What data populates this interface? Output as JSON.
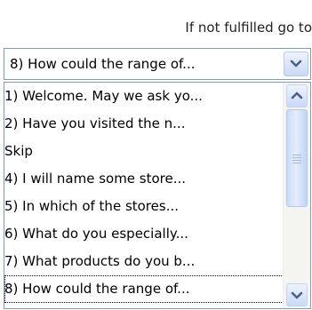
{
  "header": {
    "label": "If not fulfilled go to"
  },
  "combo": {
    "selected_value": "8) How could the range of..."
  },
  "list": {
    "items": [
      "1) Welcome. May we ask yo...",
      "2) Have you visited the n...",
      "Skip",
      "4) I will name some store...",
      "5) In which of the stores...",
      "6) What do you especially...",
      "7) What products do you b...",
      "8) How could the range of..."
    ],
    "selected_index": 7
  },
  "scrollbar": {
    "thumb_position": 0.0
  },
  "colors": {
    "border": "#7f9db9",
    "button_top": "#eef3fd",
    "button_bottom": "#c9d9f6",
    "arrow": "#4d6185"
  },
  "icons": {
    "combo_arrow": "chevron-down-icon",
    "scroll_up": "chevron-up-icon",
    "scroll_down": "chevron-down-icon"
  }
}
